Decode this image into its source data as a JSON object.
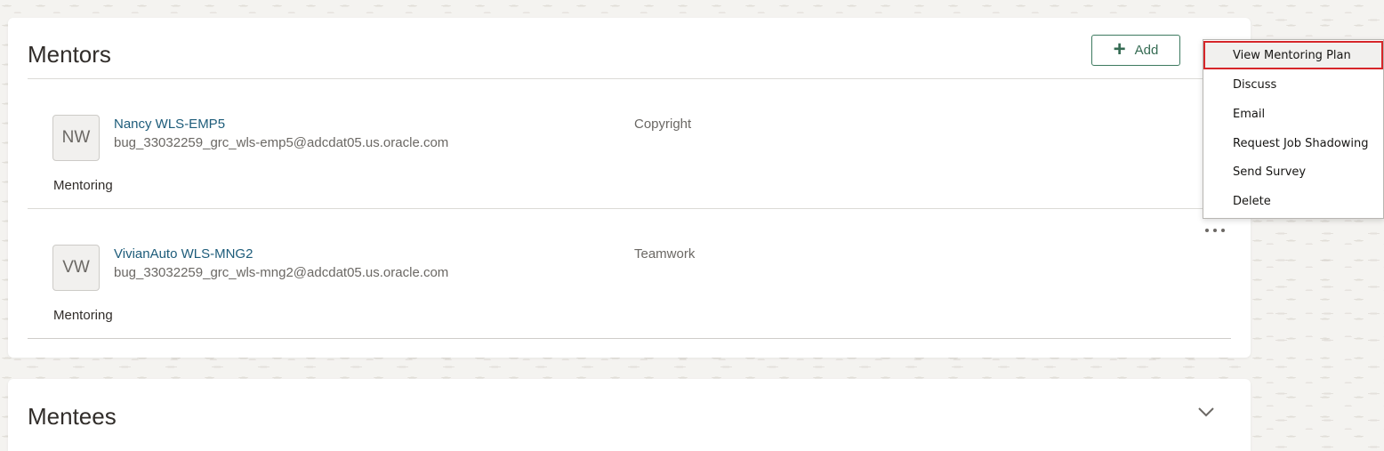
{
  "mentors": {
    "title": "Mentors",
    "add_label": "Add",
    "rows": [
      {
        "initials": "NW",
        "name": "Nancy WLS-EMP5",
        "email": "bug_33032259_grc_wls-emp5@adcdat05.us.oracle.com",
        "skill": "Copyright",
        "type": "Mentoring"
      },
      {
        "initials": "VW",
        "name": "VivianAuto WLS-MNG2",
        "email": "bug_33032259_grc_wls-mng2@adcdat05.us.oracle.com",
        "skill": "Teamwork",
        "type": "Mentoring"
      }
    ]
  },
  "mentees": {
    "title": "Mentees"
  },
  "actions_menu": {
    "items": [
      {
        "label": "View Mentoring Plan",
        "highlighted": true
      },
      {
        "label": "Discuss"
      },
      {
        "label": "Email"
      },
      {
        "label": "Request Job Shadowing"
      },
      {
        "label": "Send Survey"
      },
      {
        "label": "Delete"
      }
    ]
  },
  "colors": {
    "link": "#1d5c7a",
    "accent_green": "#356b53",
    "highlight_outline": "#d6262a"
  }
}
